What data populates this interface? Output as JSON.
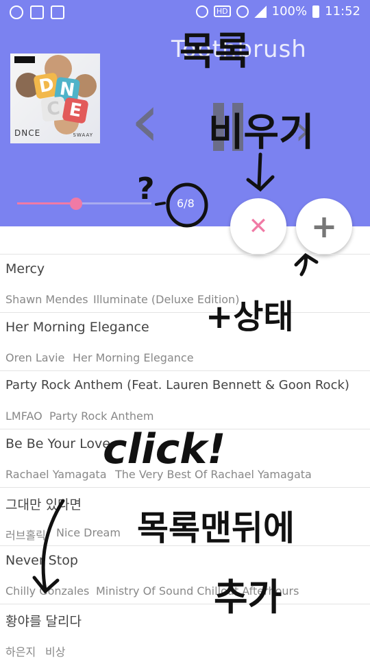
{
  "status_bar": {
    "battery": "100%",
    "time": "11:52",
    "hd_label": "HD"
  },
  "player": {
    "title": "Toothbrush",
    "position_label": "6/8",
    "progress_fraction": 0.44,
    "album_brand": "DNCE",
    "album_sub": "SWAAY",
    "clear_icon": "close-icon",
    "add_icon": "plus-icon",
    "accent_color": "#7B82F0",
    "pink_color": "#F07AA5"
  },
  "playlist": [
    {
      "title": "Mercy",
      "artist": "Shawn Mendes",
      "album": "Illuminate (Deluxe Edition)"
    },
    {
      "title": "Her Morning Elegance",
      "artist": "Oren Lavie",
      "album": "Her Morning Elegance"
    },
    {
      "title": "Party Rock Anthem (Feat. Lauren Bennett & Goon Rock)",
      "artist": "LMFAO",
      "album": "Party Rock Anthem"
    },
    {
      "title": "Be Be Your Love",
      "artist": "Rachael Yamagata",
      "album": "The Very Best Of Rachael Yamagata"
    },
    {
      "title": "그대만 있다면",
      "artist": "러브홀릭",
      "album": "Nice Dream"
    },
    {
      "title": "Never Stop",
      "artist": "Chilly Gonzales",
      "album": "Ministry Of Sound Chillout Afterhours"
    },
    {
      "title": "황야를 달리다",
      "artist": "하은지",
      "album": "비상"
    }
  ],
  "annotations": {
    "clear_list_a": "목록",
    "clear_list_b": "비우기",
    "question": "?",
    "plus_state": "+상태",
    "click": "click!",
    "append_a": "목록맨뒤에",
    "append_b": "추가"
  }
}
